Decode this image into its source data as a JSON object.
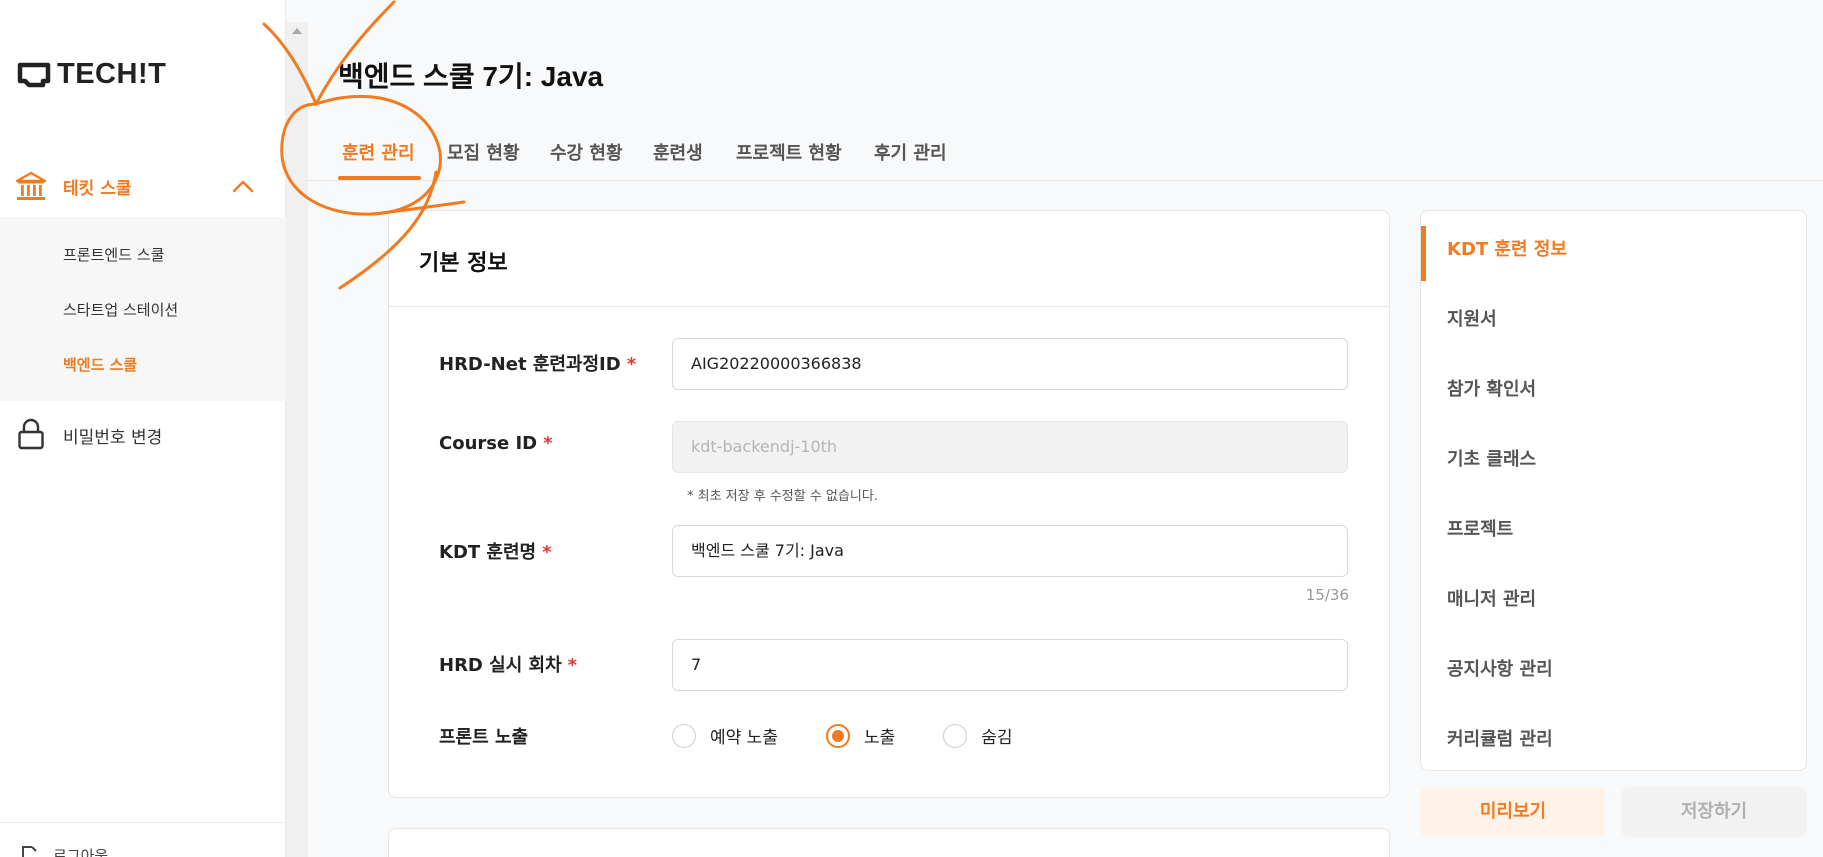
{
  "brand": {
    "logo_text": "TECH!T"
  },
  "sidebar": {
    "group": {
      "label": "테킷 스쿨",
      "icon": "bank-icon",
      "expanded": true
    },
    "sub_items": [
      {
        "label": "프론트엔드 스쿨",
        "active": false
      },
      {
        "label": "스타트업 스테이션",
        "active": false
      },
      {
        "label": "백엔드 스쿨",
        "active": true
      }
    ],
    "password_change": {
      "label": "비밀번호 변경",
      "icon": "lock-icon"
    },
    "logout": {
      "label": "로그아웃",
      "icon": "logout-icon"
    }
  },
  "page": {
    "title": "백엔드 스쿨 7기: Java"
  },
  "tabs": [
    {
      "label": "훈련 관리",
      "active": true
    },
    {
      "label": "모집 현황",
      "active": false
    },
    {
      "label": "수강 현황",
      "active": false
    },
    {
      "label": "훈련생",
      "active": false
    },
    {
      "label": "프로젝트 현황",
      "active": false
    },
    {
      "label": "후기 관리",
      "active": false
    }
  ],
  "form": {
    "section_title": "기본 정보",
    "required_mark": "*",
    "hrd_id": {
      "label": "HRD-Net 훈련과정ID",
      "value": "AIG20220000366838"
    },
    "course_id": {
      "label": "Course ID",
      "placeholder": "kdt-backendj-10th",
      "hint": "* 최초 저장 후 수정할 수 없습니다."
    },
    "kdt_name": {
      "label": "KDT 훈련명",
      "value": "백엔드 스쿨 7기: Java",
      "counter": "15/36"
    },
    "hrd_round": {
      "label": "HRD 실시 회차",
      "value": "7"
    },
    "front_visibility": {
      "label": "프론트 노출",
      "options": [
        {
          "label": "예약 노출",
          "selected": false
        },
        {
          "label": "노출",
          "selected": true
        },
        {
          "label": "숨김",
          "selected": false
        }
      ]
    }
  },
  "side_menu": [
    {
      "label": "KDT 훈련 정보",
      "active": true
    },
    {
      "label": "지원서",
      "active": false
    },
    {
      "label": "참가 확인서",
      "active": false
    },
    {
      "label": "기초 클래스",
      "active": false
    },
    {
      "label": "프로젝트",
      "active": false
    },
    {
      "label": "매니저 관리",
      "active": false
    },
    {
      "label": "공지사항 관리",
      "active": false
    },
    {
      "label": "커리큘럼 관리",
      "active": false
    }
  ],
  "actions": {
    "preview_label": "미리보기",
    "save_label": "저장하기"
  },
  "colors": {
    "accent": "#f27a1f",
    "required": "#e53935"
  }
}
